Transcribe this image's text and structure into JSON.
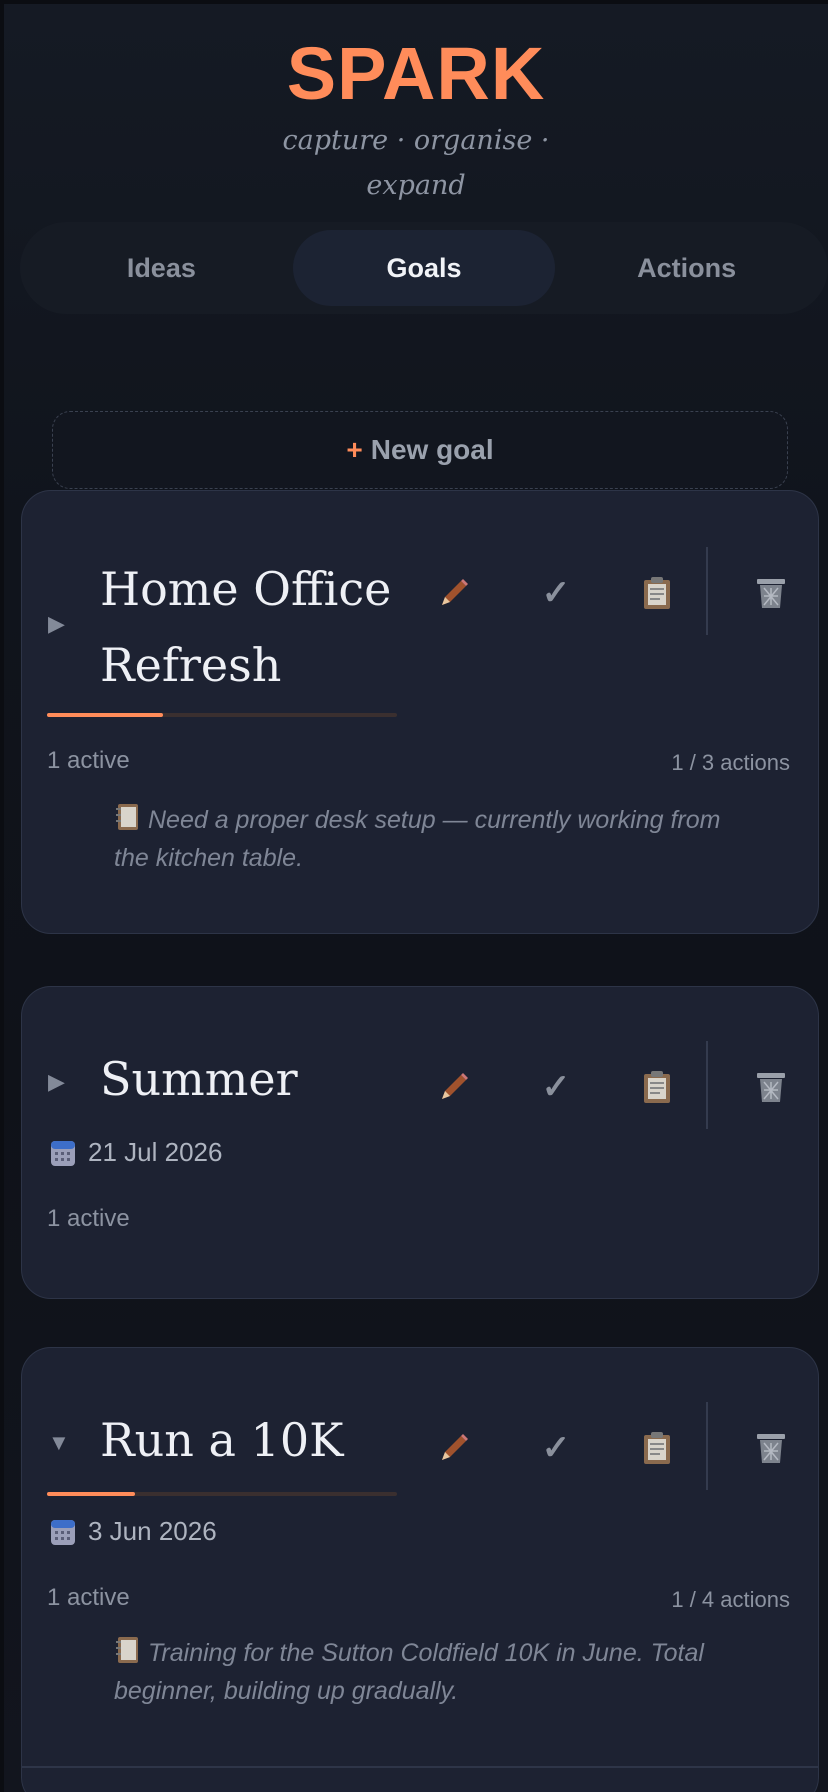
{
  "app": {
    "title": "SPARK",
    "tagline": "capture · organise · expand",
    "accent_color": "#ff8c5a"
  },
  "tabs": [
    {
      "label": "Ideas",
      "active": false
    },
    {
      "label": "Goals",
      "active": true
    },
    {
      "label": "Actions",
      "active": false
    }
  ],
  "new_goal": {
    "icon": "+",
    "label": "New goal"
  },
  "goals": [
    {
      "title": "Home Office Refresh",
      "expanded": false,
      "toggle_icon": "▶",
      "progress": 0.33,
      "active_label": "1 active",
      "actions_label": "1 / 3 actions",
      "note": "Need a proper desk setup — currently working from the kitchen table.",
      "date": ""
    },
    {
      "title": "Summer",
      "expanded": false,
      "toggle_icon": "▶",
      "progress": null,
      "active_label": "1 active",
      "actions_label": "",
      "note": "",
      "date": "21 Jul 2026"
    },
    {
      "title": "Run a 10K",
      "expanded": true,
      "toggle_icon": "▼",
      "progress": 0.25,
      "active_label": "1 active",
      "actions_label": "1 / 4 actions",
      "note": "Training for the Sutton Coldfield 10K in June. Total beginner, building up gradually.",
      "date": "3 Jun 2026"
    }
  ],
  "icons": {
    "edit": "pencil-icon",
    "complete": "checkmark-icon",
    "notes": "clipboard-icon",
    "delete": "trash-icon",
    "date": "calendar-icon",
    "note": "notebook-icon"
  },
  "checkmark_glyph": "✓"
}
